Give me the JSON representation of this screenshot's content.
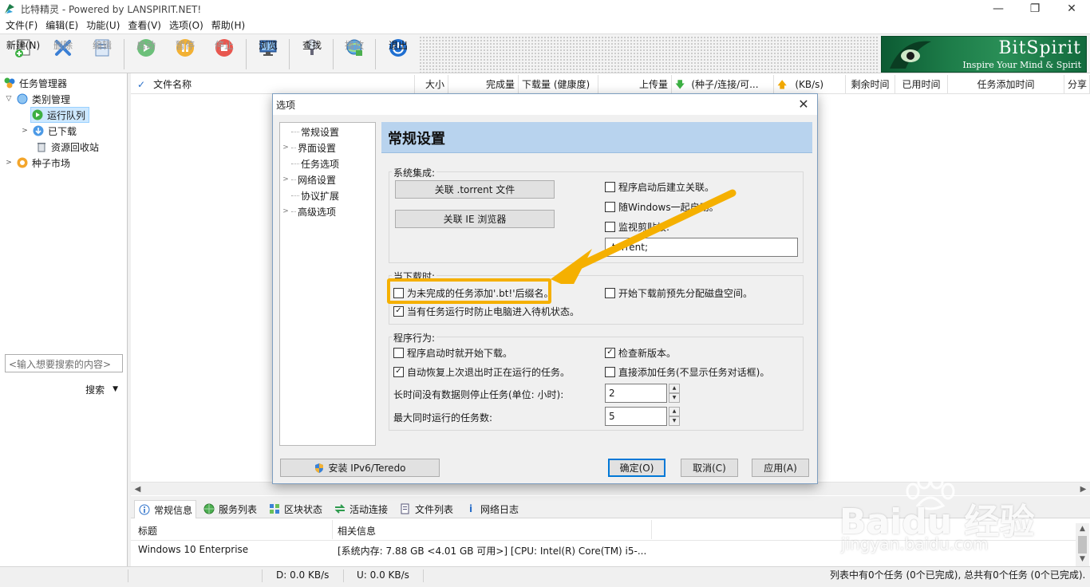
{
  "window": {
    "title": "比特精灵 - Powered by LANSPIRIT.NET!",
    "controls": {
      "minimize": "—",
      "maximize": "❐",
      "close": "✕"
    }
  },
  "menubar": [
    "文件(F)",
    "编辑(E)",
    "功能(U)",
    "查看(V)",
    "选项(O)",
    "帮助(H)"
  ],
  "toolbar": {
    "new": "新建(N)",
    "delete": "删除",
    "edit": "编辑",
    "start": "启动",
    "pause": "暂停",
    "stop": "停止",
    "browse": "浏览",
    "find": "查找",
    "play": "播放",
    "exit": "退出"
  },
  "brand": {
    "name": "BitSpirit",
    "slogan": "Inspire Your Mind & Spirit"
  },
  "sidebar": {
    "items": [
      {
        "label": "任务管理器",
        "icon": "task-manager-icon"
      },
      {
        "label": "类别管理",
        "icon": "category-icon"
      },
      {
        "label": "运行队列",
        "icon": "run-queue-icon"
      },
      {
        "label": "已下载",
        "icon": "downloaded-icon"
      },
      {
        "label": "资源回收站",
        "icon": "recycle-bin-icon"
      },
      {
        "label": "种子市场",
        "icon": "torrent-market-icon"
      }
    ],
    "search_placeholder": "<输入想要搜索的内容>",
    "search_button": "搜索"
  },
  "list": {
    "columns": [
      "文件名称",
      "大小",
      "完成量",
      "下载量 (健康度)",
      "上传量",
      "(种子/连接/可...",
      "(KB/s)",
      "剩余时间",
      "已用时间",
      "任务添加时间",
      "分享"
    ]
  },
  "info_tabs": [
    "常规信息",
    "服务列表",
    "区块状态",
    "活动连接",
    "文件列表",
    "网络日志"
  ],
  "info_table": {
    "headers": [
      "标题",
      "相关信息"
    ],
    "rows": [
      [
        "Windows 10 Enterprise",
        "[系统内存: 7.88 GB <4.01 GB 可用>] [CPU: Intel(R) Core(TM) i5-..."
      ]
    ]
  },
  "statusbar": {
    "download": "D: 0.0 KB/s",
    "upload": "U: 0.0 KB/s",
    "summary": "列表中有0个任务 (0个已完成), 总共有0个任务 (0个已完成)."
  },
  "dialog": {
    "title": "选项",
    "tree": [
      "常规设置",
      "界面设置",
      "任务选项",
      "网络设置",
      "协议扩展",
      "高级选项"
    ],
    "panel_title": "常规设置",
    "system_integration": {
      "label": "系统集成:",
      "assoc_torrent": "关联 .torrent 文件",
      "assoc_ie": "关联 IE 浏览器",
      "chk_assoc_on_start": "程序启动后建立关联。",
      "chk_start_with_windows": "随Windows一起启动。",
      "chk_monitor_clipboard": "监视剪贴板:",
      "clipboard_value": ".torrent;"
    },
    "when_downloading": {
      "label": "当下载时:",
      "chk_bt_suffix": "为未完成的任务添加'.bt!'后缀名。",
      "chk_prevent_standby": "当有任务运行时防止电脑进入待机状态。",
      "chk_prealloc": "开始下载前预先分配磁盘空间。"
    },
    "behavior": {
      "label": "程序行为:",
      "chk_auto_start": "程序启动时就开始下载。",
      "chk_restore_tasks": "自动恢复上次退出时正在运行的任务。",
      "chk_check_version": "检查新版本。",
      "chk_direct_add": "直接添加任务(不显示任务对话框)。",
      "idle_stop_label": "长时间没有数据则停止任务(单位: 小时):",
      "idle_stop_value": "2",
      "max_tasks_label": "最大同时运行的任务数:",
      "max_tasks_value": "5"
    },
    "buttons": {
      "ipv6": "安装 IPv6/Teredo",
      "ok": "确定(O)",
      "cancel": "取消(C)",
      "apply": "应用(A)"
    }
  },
  "watermark": {
    "brand": "Baidu 经验",
    "url": "jingyan.baidu.com"
  },
  "colors": {
    "annotation": "#f5b000",
    "panel_header": "#b8d3ee",
    "brand_green": "#1e7e4a"
  }
}
